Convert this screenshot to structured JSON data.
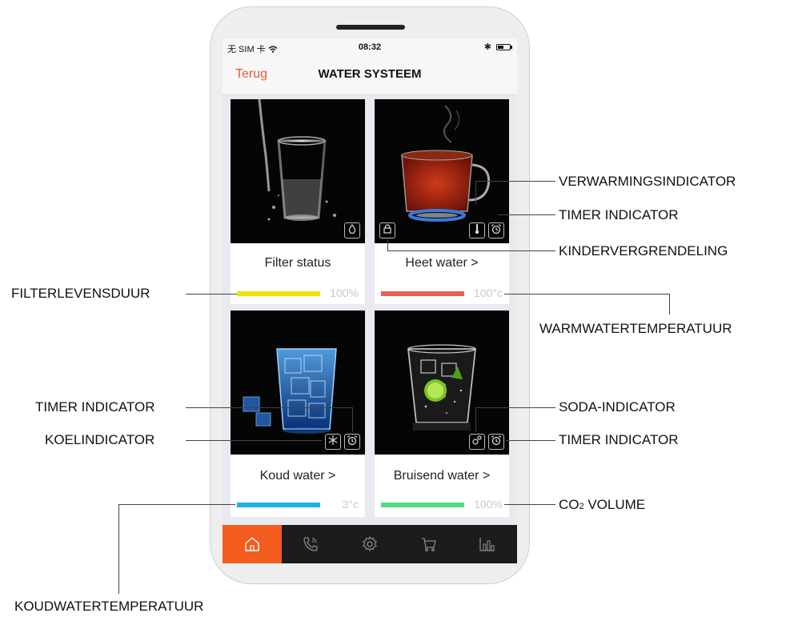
{
  "status_bar": {
    "carrier": "无 SIM 卡",
    "time": "08:32",
    "bluetooth": "✱"
  },
  "nav": {
    "back_label": "Terug",
    "title": "WATER SYSTEEM"
  },
  "cards": [
    {
      "label": "Filter status",
      "value": "100%",
      "bar_color": "#f0e010",
      "level": 1.0,
      "badges": [
        "drop-icon"
      ]
    },
    {
      "label": "Heet water >",
      "value": "100°c",
      "bar_color": "#e8614d",
      "level": 1.0,
      "badges": [
        "lock-icon",
        "thermometer-icon",
        "alarm-clock-icon"
      ]
    },
    {
      "label": "Koud water >",
      "value": "3°c",
      "bar_color": "#1eb0e8",
      "level": 1.0,
      "badges": [
        "snowflake-icon",
        "alarm-clock-icon"
      ]
    },
    {
      "label": "Bruisend water >",
      "value": "100%",
      "bar_color": "#4fdc83",
      "level": 1.0,
      "badges": [
        "bubbles-icon",
        "alarm-clock-icon"
      ]
    }
  ],
  "tabs": [
    {
      "name": "home-icon",
      "active": true
    },
    {
      "name": "phone-icon",
      "active": false
    },
    {
      "name": "settings-icon",
      "active": false
    },
    {
      "name": "cart-icon",
      "active": false
    },
    {
      "name": "stats-icon",
      "active": false
    }
  ],
  "annotations": {
    "verwarmingsindicator": "VERWARMINGSINDICATOR",
    "timer_hot": "TIMER INDICATOR",
    "kindervergrendeling": "KINDERVERGRENDELING",
    "filterlevensduur": "FILTERLEVENSDUUR",
    "warmwatertemperatuur": "WARMWATERTEMPERATUUR",
    "timer_cold": "TIMER INDICATOR",
    "koelindicator": "KOELINDICATOR",
    "soda_indicator": "SODA-INDICATOR",
    "timer_soda": "TIMER INDICATOR",
    "co2_volume_prefix": "CO",
    "co2_volume_sub": "2",
    "co2_volume_suffix": " VOLUME",
    "koudwatertemperatuur": "KOUDWATERTEMPERATUUR"
  },
  "colors": {
    "accent": "#f25c1f",
    "back": "#e85a3a",
    "tabbar": "#1c1c1c"
  }
}
